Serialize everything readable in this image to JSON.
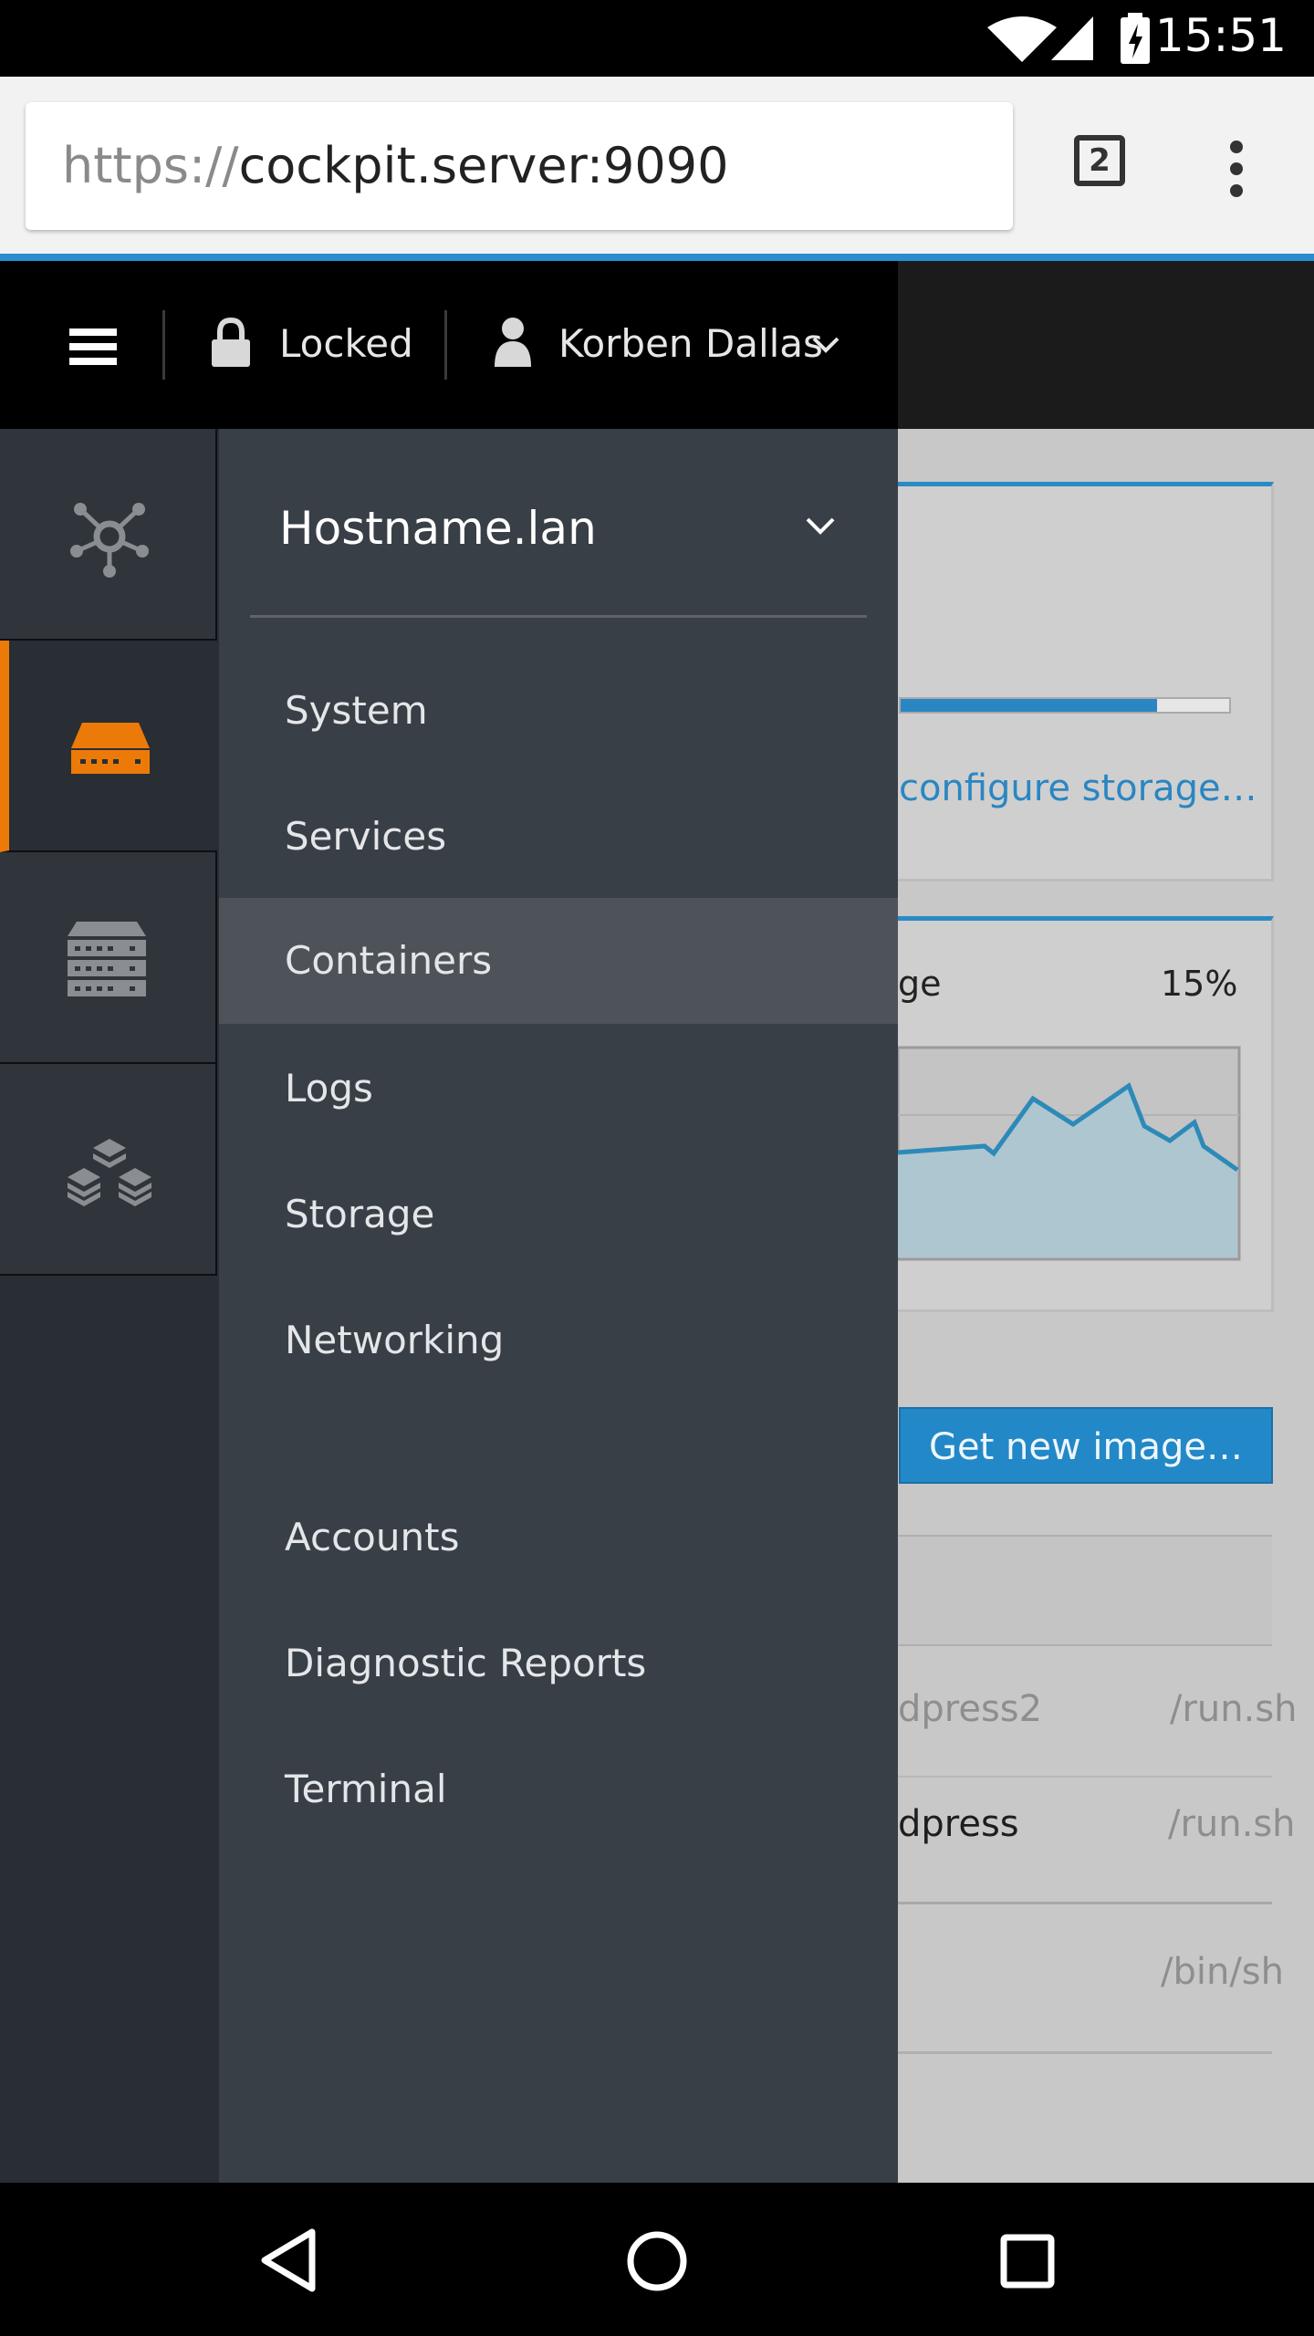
{
  "status_bar": {
    "time": "15:51"
  },
  "browser": {
    "url_scheme": "https://",
    "url_host": "cockpit.server:9090",
    "tab_count": "2"
  },
  "masthead": {
    "lock_label": "Locked",
    "user_name": "Korben Dallas"
  },
  "host_menu": {
    "hostname": "Hostname.lan",
    "items": [
      {
        "label": "System"
      },
      {
        "label": "Services"
      },
      {
        "label": "Containers",
        "selected": true
      },
      {
        "label": "Logs"
      },
      {
        "label": "Storage"
      },
      {
        "label": "Networking"
      },
      {
        "label": "Accounts"
      },
      {
        "label": "Diagnostic Reports"
      },
      {
        "label": "Terminal"
      }
    ]
  },
  "vertical_nav": [
    {
      "icon": "network-nodes-icon",
      "active": false
    },
    {
      "icon": "server-icon",
      "active": true
    },
    {
      "icon": "servers-stack-icon",
      "active": false
    },
    {
      "icon": "layers-icon",
      "active": false
    }
  ],
  "background_page": {
    "storage_link": "configure storage…",
    "usage_label_fragment": "ge",
    "usage_percent": "15%",
    "storage_usage_fraction": 0.78,
    "new_image_button": "Get new image…",
    "rows": [
      {
        "name": "dpress2",
        "command": "/run.sh"
      },
      {
        "name": "dpress",
        "command": "/run.sh"
      },
      {
        "name": "",
        "command": "/bin/sh"
      }
    ]
  },
  "colors": {
    "accent_orange": "#ec7a08",
    "accent_blue": "#2a8bc4",
    "menu_bg": "#393f47",
    "menu_selected": "#4d5359"
  }
}
